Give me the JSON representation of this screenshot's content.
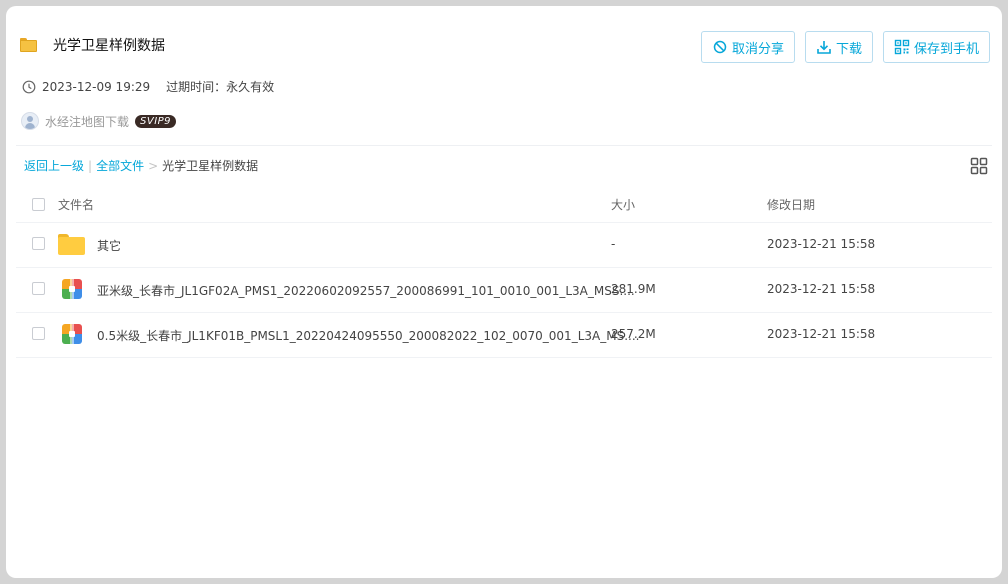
{
  "share": {
    "folder_name": "光学卫星样例数据",
    "date": "2023-12-09 19:29",
    "expire_label": "过期时间：永久有效",
    "user_name": "水经注地图下载",
    "user_badge": "SVIP9"
  },
  "actions": {
    "cancel_label": "取消分享",
    "download_label": "下载",
    "save_label": "保存到手机"
  },
  "breadcrumb": {
    "back_label": "返回上一级",
    "separator": "|",
    "all_files_label": "全部文件",
    "arrow": ">",
    "current": "光学卫星样例数据"
  },
  "table": {
    "headers": {
      "name": "文件名",
      "size": "大小",
      "date": "修改日期"
    },
    "rows": [
      {
        "name": "其它",
        "size": "-",
        "date": "2023-12-21 15:58",
        "icon": "folder-icon"
      },
      {
        "name": "亚米级_长春市_JL1GF02A_PMS1_20220602092557_200086991_101_0010_001_L3A_MSS....",
        "size": "281.9M",
        "date": "2023-12-21 15:58",
        "icon": "zip-icon"
      },
      {
        "name": "0.5米级_长春市_JL1KF01B_PMSL1_20220424095550_200082022_102_0070_001_L3A_MS....",
        "size": "257.2M",
        "date": "2023-12-21 15:58",
        "icon": "zip-icon"
      }
    ]
  },
  "colors": {
    "accent": "#06a7d9",
    "folder": "#ffcc40",
    "badge_bg": "#3a2a25"
  }
}
